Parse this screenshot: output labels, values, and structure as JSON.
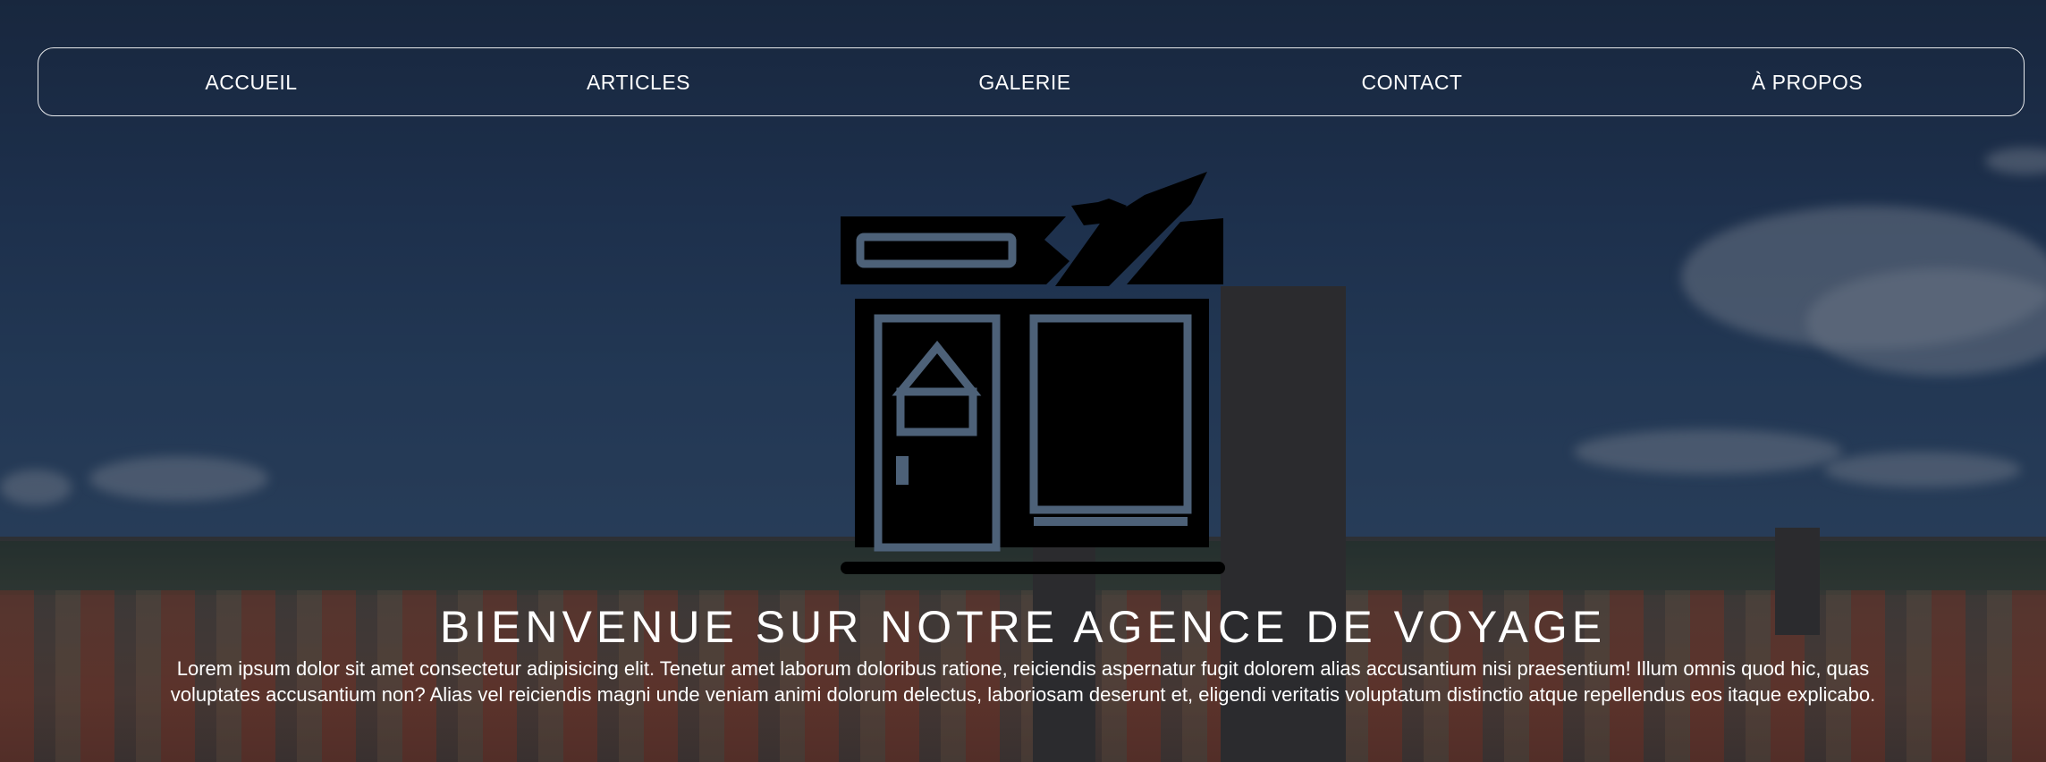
{
  "nav": {
    "items": [
      {
        "label": "ACCUEIL"
      },
      {
        "label": "ARTICLES"
      },
      {
        "label": "GALERIE"
      },
      {
        "label": "CONTACT"
      },
      {
        "label": "À PROPOS"
      }
    ]
  },
  "hero": {
    "logo_icon": "travel-agency-icon",
    "title": "BIENVENUE SUR NOTRE AGENCE DE VOYAGE",
    "text": "Lorem ipsum dolor sit amet consectetur adipisicing elit. Tenetur amet laborum doloribus ratione, reiciendis aspernatur fugit dolorem alias accusantium nisi praesentium! Illum omnis quod hic, quas voluptates accusantium non? Alias vel reiciendis magni unde veniam animi dolorum delectus, laboriosam deserunt et, eligendi veritatis voluptatum distinctio atque repellendus eos itaque explicabo."
  },
  "colors": {
    "text": "#ffffff",
    "logo": "#000000",
    "sky": "#223a5a"
  }
}
